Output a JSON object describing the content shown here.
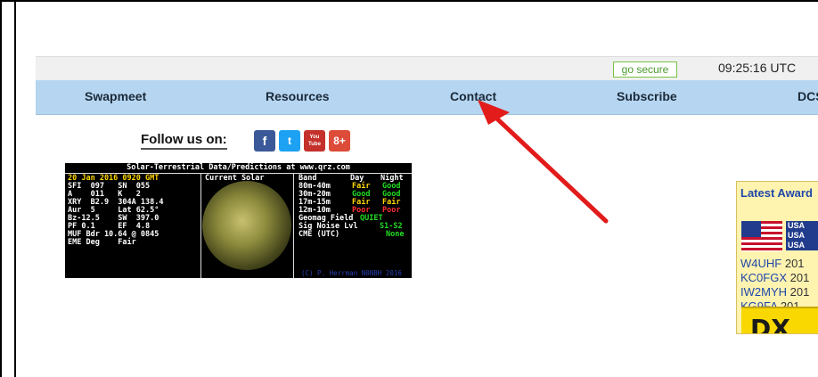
{
  "topbar": {
    "go_secure": "go secure",
    "time": "09:25:16 UTC"
  },
  "nav": [
    {
      "label": "Swapmeet"
    },
    {
      "label": "Resources"
    },
    {
      "label": "Contact"
    },
    {
      "label": "Subscribe"
    },
    {
      "label": "DCS"
    }
  ],
  "follow": {
    "label": "Follow us on:"
  },
  "social_icons": [
    "facebook-icon",
    "twitter-icon",
    "youtube-icon",
    "google-plus-icon"
  ],
  "social": {
    "facebook": "f",
    "twitter": "t",
    "youtube": "You Tube",
    "gplus": "8+"
  },
  "solar": {
    "title": "Solar-Terrestrial Data/Predictions at www.qrz.com",
    "date_line": "20 Jan 2016 0920 GMT",
    "current_solar": "Current Solar",
    "rows_left": [
      "SFI  097   SN  055",
      "A    011   K   2",
      "XRY  B2.9  304A 138.4",
      "Aur  5     Lat 62.5°",
      "Bz-12.5    SW  397.0",
      "PF 0.1     EF  4.8",
      "MUF Bdr 10.64 @ 0845",
      "EME Deg    Fair"
    ],
    "band_header": [
      "Band",
      "Day",
      "Night"
    ],
    "bands": [
      {
        "band": "80m-40m",
        "day": "Fair",
        "night": "Good"
      },
      {
        "band": "30m-20m",
        "day": "Good",
        "night": "Good"
      },
      {
        "band": "17m-15m",
        "day": "Fair",
        "night": "Fair"
      },
      {
        "band": "12m-10m",
        "day": "Poor",
        "night": "Poor"
      }
    ],
    "geomag_label": "Geomag Field",
    "geomag_value": "QUIET",
    "noise_label": "Sig Noise Lvl",
    "noise_value": "S1-S2",
    "cme_label": "CME (UTC)",
    "cme_value": "None",
    "credit": "(C) P. Herrman N0NBH 2016"
  },
  "award": {
    "title": "Latest Award",
    "flag_text": [
      "USA",
      "USA",
      "USA"
    ],
    "rows": [
      {
        "call": "W4UHF",
        "year": "201"
      },
      {
        "call": "KC0FGX",
        "year": "201"
      },
      {
        "call": "IW2MYH",
        "year": "201"
      },
      {
        "call": "KG9FA",
        "year": "201"
      }
    ],
    "dx_logo": "DX"
  }
}
